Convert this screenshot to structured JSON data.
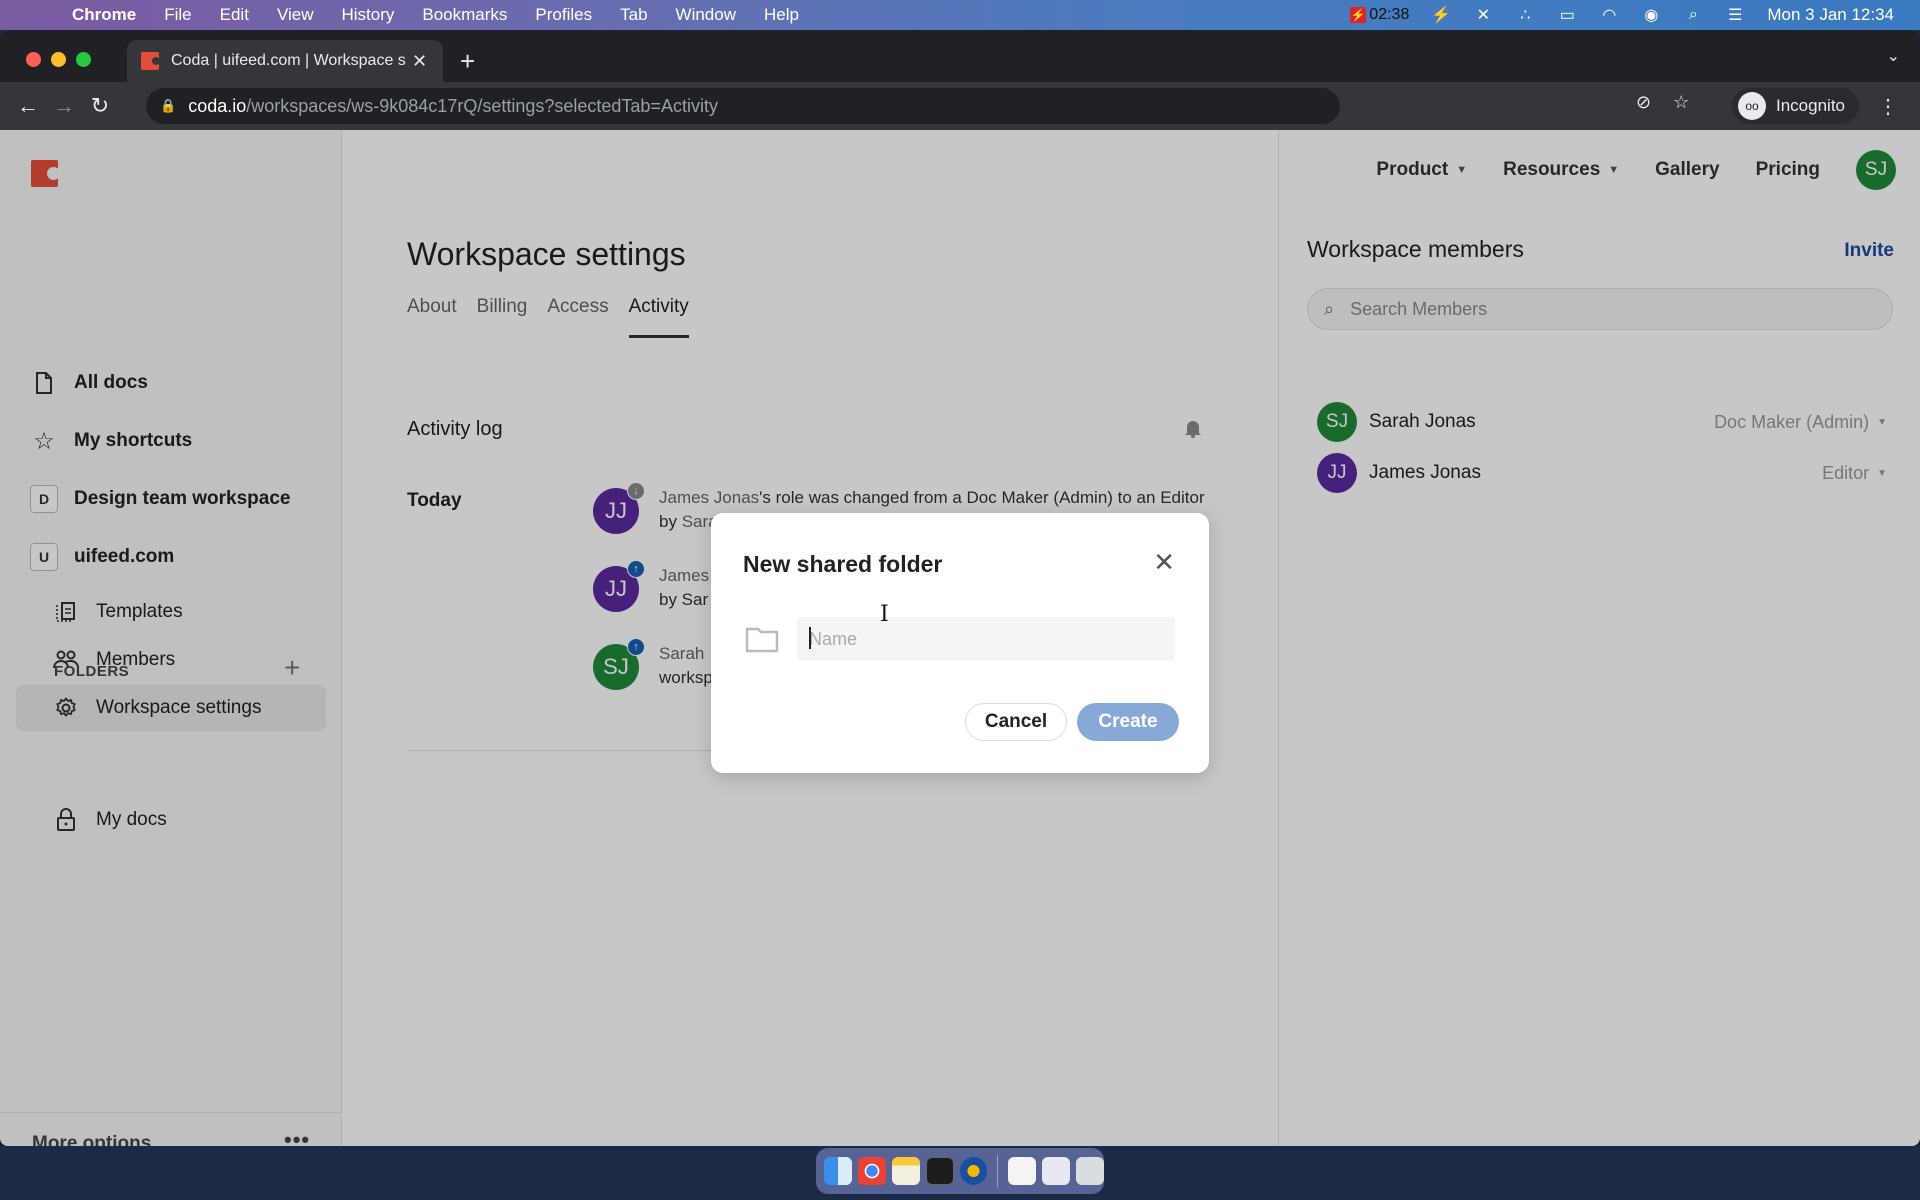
{
  "menubar": {
    "app": "Chrome",
    "items": [
      "File",
      "Edit",
      "View",
      "History",
      "Bookmarks",
      "Profiles",
      "Tab",
      "Window",
      "Help"
    ],
    "recording_time": "02:38",
    "datetime": "Mon 3 Jan  12:34"
  },
  "browser": {
    "tab_title": "Coda | uifeed.com | Workspace settings",
    "url_host": "coda.io",
    "url_path": "/workspaces/ws-9k084c17rQ/settings?selectedTab=Activity",
    "profile_label": "Incognito"
  },
  "sidebar": {
    "items": [
      {
        "label": "All docs",
        "icon": "document-icon"
      },
      {
        "label": "My shortcuts",
        "icon": "star-icon"
      },
      {
        "label": "Design team workspace",
        "letter": "D"
      },
      {
        "label": "uifeed.com",
        "letter": "U"
      }
    ],
    "sub_items": [
      {
        "label": "Templates",
        "icon": "templates-icon"
      },
      {
        "label": "Members",
        "icon": "members-icon"
      },
      {
        "label": "Workspace settings",
        "icon": "gear-icon",
        "active": true
      }
    ],
    "folders_label": "FOLDERS",
    "folders": [
      {
        "label": "My docs",
        "icon": "lock-icon"
      }
    ],
    "more_options": "More options"
  },
  "topnav": {
    "links": [
      "Product",
      "Resources",
      "Gallery",
      "Pricing"
    ],
    "user_initials": "SJ"
  },
  "main": {
    "title": "Workspace settings",
    "tabs": [
      "About",
      "Billing",
      "Access",
      "Activity"
    ],
    "active_tab": "Activity",
    "activity_log_title": "Activity log",
    "group_label": "Today",
    "entries": [
      {
        "initials": "JJ",
        "color": "#5b2a9e",
        "badge": "down",
        "name": "James Jonas",
        "text": "'s role was changed from a Doc Maker (Admin) to an Editor by ",
        "actor": "Sarah Jonas",
        "end": "."
      },
      {
        "initials": "JJ",
        "color": "#5b2a9e",
        "badge": "up",
        "name": "James",
        "text": "",
        "line2": "by Sar"
      },
      {
        "initials": "SJ",
        "color": "#1f8a3a",
        "badge": "up",
        "name": "Sarah",
        "text": "",
        "line2": "worksp"
      }
    ]
  },
  "members_panel": {
    "title": "Workspace members",
    "invite_label": "Invite",
    "search_placeholder": "Search Members",
    "members": [
      {
        "initials": "SJ",
        "name": "Sarah Jonas",
        "role": "Doc Maker (Admin)",
        "color": "#1f8a3a"
      },
      {
        "initials": "JJ",
        "name": "James Jonas",
        "role": "Editor",
        "color": "#5b2a9e"
      }
    ]
  },
  "modal": {
    "title": "New shared folder",
    "name_placeholder": "Name",
    "name_value": "",
    "cancel_label": "Cancel",
    "create_label": "Create"
  }
}
